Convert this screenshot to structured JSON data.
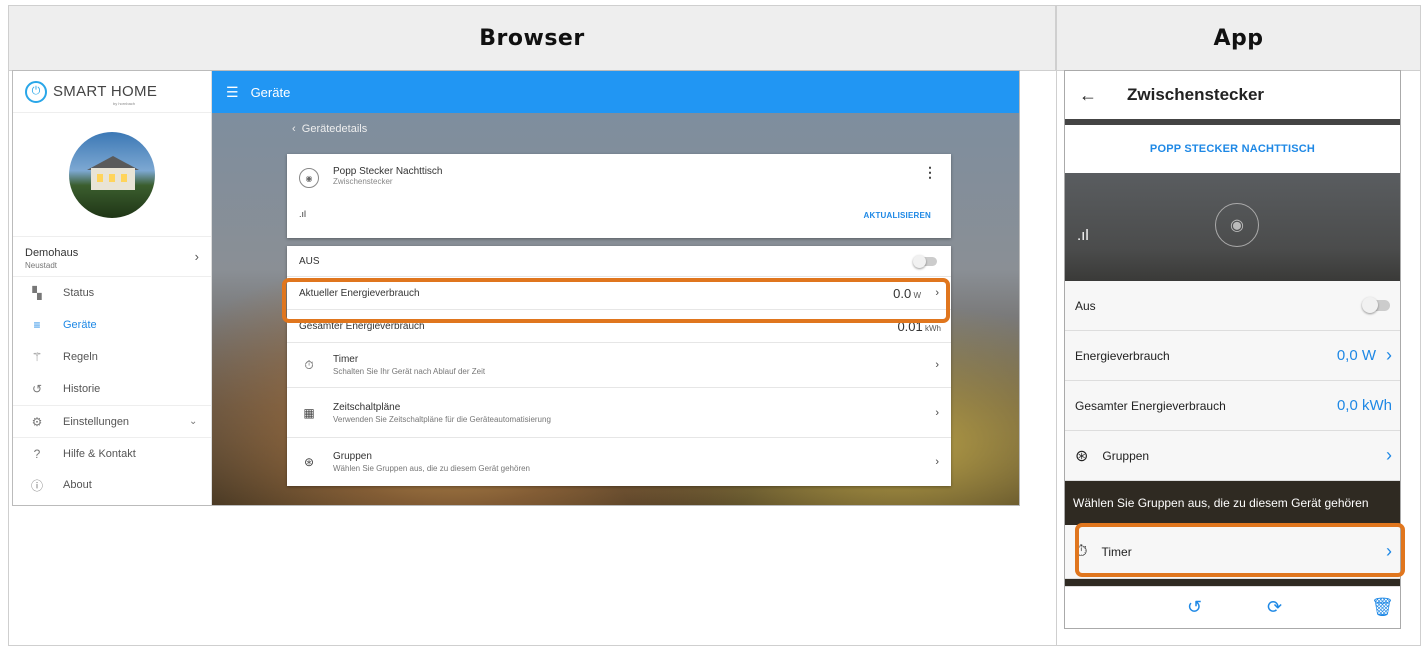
{
  "headers": {
    "browser": "Browser",
    "app": "App"
  },
  "browser": {
    "logo": {
      "text": "SMART HOME",
      "sub": "by hornbach"
    },
    "home": {
      "name": "Demohaus",
      "location": "Neustadt"
    },
    "nav": [
      {
        "label": "Status",
        "icon": "dashboard-icon"
      },
      {
        "label": "Geräte",
        "icon": "list-icon",
        "active": true
      },
      {
        "label": "Regeln",
        "icon": "wand-icon"
      },
      {
        "label": "Historie",
        "icon": "history-icon"
      },
      {
        "label": "Einstellungen",
        "icon": "gear-icon"
      },
      {
        "label": "Hilfe & Kontakt",
        "icon": "help-icon"
      },
      {
        "label": "About",
        "icon": "info-icon"
      }
    ],
    "topbar_title": "Geräte",
    "breadcrumb": "Gerätedetails",
    "device": {
      "name": "Popp Stecker Nachttisch",
      "type": "Zwischenstecker",
      "signal": ".ıl",
      "update": "AKTUALISIEREN"
    },
    "rows": {
      "switch": "AUS",
      "current_energy": {
        "label": "Aktueller Energieverbrauch",
        "value": "0.0",
        "unit": "W"
      },
      "total_energy": {
        "label": "Gesamter Energieverbrauch",
        "value": "0.01",
        "unit": "kWh"
      },
      "timer": {
        "title": "Timer",
        "subtitle": "Schalten Sie Ihr Gerät nach Ablauf der Zeit"
      },
      "schedules": {
        "title": "Zeitschaltpläne",
        "subtitle": "Verwenden Sie Zeitschaltpläne für die Geräteautomatisierung"
      },
      "groups": {
        "title": "Gruppen",
        "subtitle": "Wählen Sie Gruppen aus, die zu diesem Gerät gehören"
      }
    }
  },
  "app": {
    "title": "Zwischenstecker",
    "device_name": "POPP STECKER NACHTTISCH",
    "signal": ".ıl",
    "switch_label": "Aus",
    "energy": {
      "label": "Energieverbrauch",
      "value": "0,0 W"
    },
    "total_energy": {
      "label": "Gesamter Energieverbrauch",
      "value": "0,0 kWh"
    },
    "groups": {
      "label": "Gruppen",
      "note": "Wählen Sie Gruppen aus, die zu diesem Gerät gehören"
    },
    "timer": {
      "label": "Timer"
    }
  }
}
